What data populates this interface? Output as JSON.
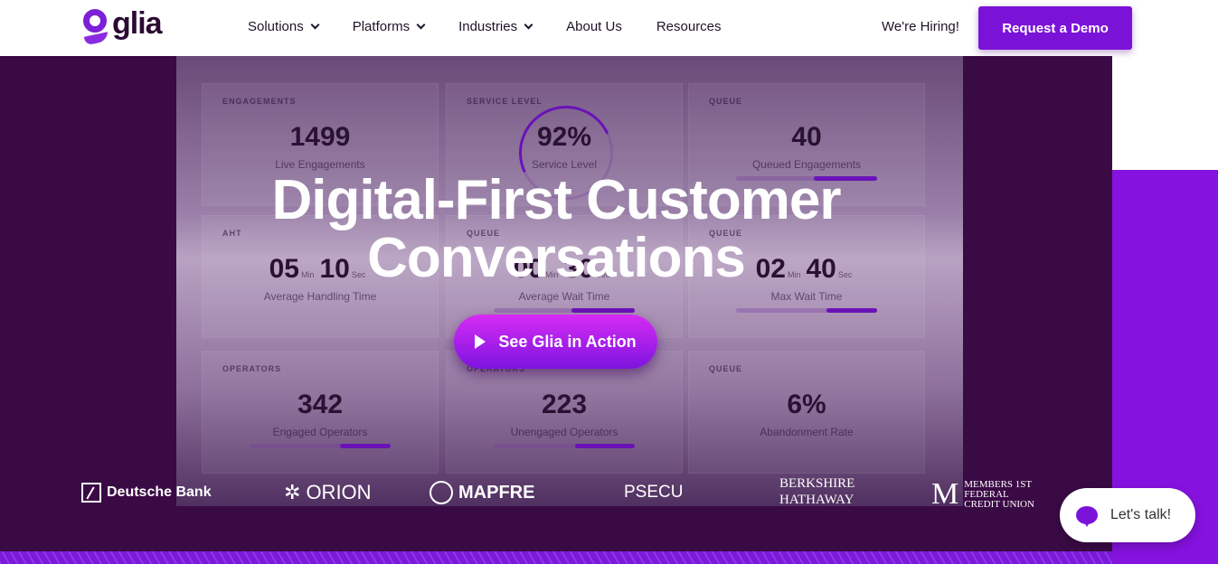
{
  "header": {
    "logo": "glia",
    "nav": [
      {
        "label": "Solutions",
        "dropdown": true
      },
      {
        "label": "Platforms",
        "dropdown": true
      },
      {
        "label": "Industries",
        "dropdown": true
      },
      {
        "label": "About Us",
        "dropdown": false
      },
      {
        "label": "Resources",
        "dropdown": false
      }
    ],
    "hiring": "We're Hiring!",
    "demo": "Request a Demo"
  },
  "dashboard": {
    "cards": [
      {
        "label": "ENGAGEMENTS",
        "value": "1499",
        "sub": "Live Engagements"
      },
      {
        "label": "SERVICE LEVEL",
        "value": "92%",
        "sub": "Service Level",
        "gauge_percent": 92
      },
      {
        "label": "QUEUE",
        "value": "40",
        "sub": "Queued Engagements",
        "bar_percent": 45
      },
      {
        "label": "AHT",
        "min": "05",
        "sec": "10",
        "sub": "Average Handling Time"
      },
      {
        "label": "QUEUE",
        "min": "00",
        "sec": "30",
        "sub": "Average Wait Time",
        "bar_percent": 45
      },
      {
        "label": "QUEUE",
        "min": "02",
        "sec": "40",
        "sub": "Max Wait Time",
        "bar_percent": 36
      },
      {
        "label": "OPERATORS",
        "value": "342",
        "sub": "Engaged Operators",
        "bar_percent": 36
      },
      {
        "label": "OPERATORS",
        "value": "223",
        "sub": "Unengaged Operators",
        "bar_percent": 42
      },
      {
        "label": "QUEUE",
        "value": "6%",
        "sub": "Abandonment Rate"
      }
    ],
    "min_unit": "Min",
    "sec_unit": "Sec"
  },
  "hero": {
    "line1": "Digital-First Customer",
    "line2": "Conversations",
    "cta": "See Glia in Action"
  },
  "logos": [
    "Deutsche Bank",
    "ORION",
    "MAPFRE",
    "PSECU",
    "Berkshire Hathaway",
    "Members 1st Federal Credit Union"
  ],
  "chat": {
    "label": "Let's talk!"
  },
  "colors": {
    "brand": "#7b12d8",
    "hero_bg": "#3a0a45"
  }
}
